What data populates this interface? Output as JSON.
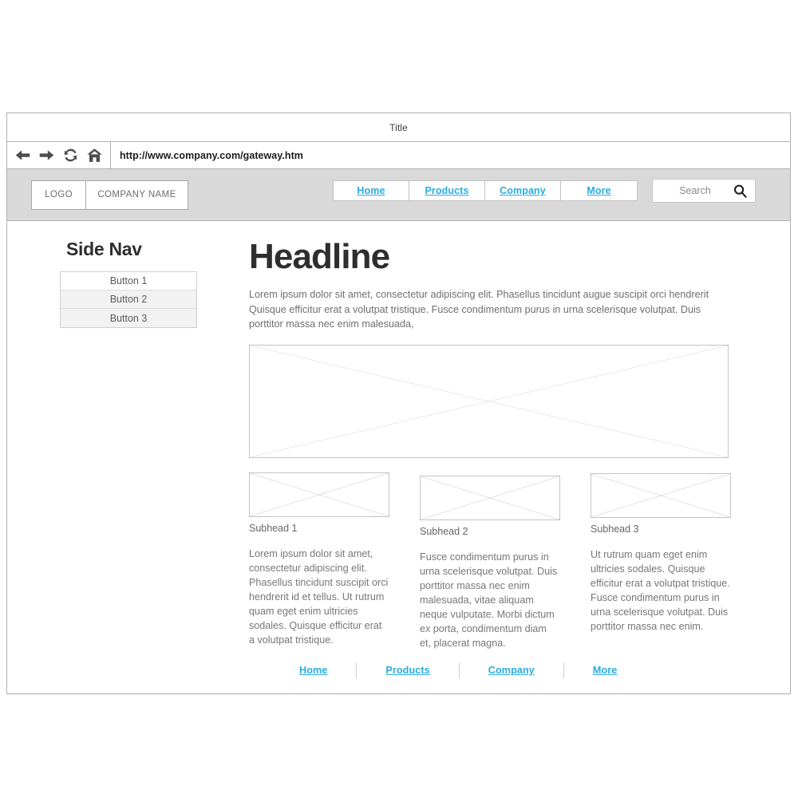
{
  "browser": {
    "title": "Title",
    "url": "http://www.company.com/gateway.htm",
    "nav_icons": {
      "back": "back-arrow-icon",
      "forward": "forward-arrow-icon",
      "reload": "reload-icon",
      "home": "home-icon"
    }
  },
  "site_header": {
    "logo_label": "LOGO",
    "company_name": "COMPANY NAME",
    "nav": [
      {
        "label": "Home"
      },
      {
        "label": "Products"
      },
      {
        "label": "Company"
      },
      {
        "label": "More"
      }
    ],
    "search": {
      "placeholder": "Search",
      "icon": "magnifier-icon"
    }
  },
  "side_nav": {
    "title": "Side Nav",
    "buttons": [
      {
        "label": "Button 1",
        "state": "active"
      },
      {
        "label": "Button 2",
        "state": "idle"
      },
      {
        "label": "Button 3",
        "state": "idle"
      }
    ]
  },
  "main": {
    "headline": "Headline",
    "intro": "Lorem ipsum dolor sit amet, consectetur adipiscing elit. Phasellus tincidunt augue suscipit orci hendrerit Quisque efficitur erat a volutpat tristique. Fusce condimentum purus in urna scelerisque volutpat. Duis porttitor massa nec enim malesuada,",
    "hero_image_alt": "image-placeholder",
    "columns": [
      {
        "subhead": "Subhead 1",
        "text": "Lorem ipsum dolor sit amet, consectetur adipiscing elit. Phasellus tincidunt suscipit orci hendrerit id et tellus. Ut rutrum quam eget enim ultricies sodales. Quisque efficitur erat a volutpat tristique."
      },
      {
        "subhead": "Subhead 2",
        "text": " Fusce condimentum purus in urna scelerisque volutpat. Duis porttitor massa nec enim malesuada, vitae aliquam neque vulputate. Morbi dictum ex porta, condimentum diam et, placerat magna."
      },
      {
        "subhead": "Subhead 3",
        "text": "Ut rutrum quam eget enim ultricies sodales. Quisque efficitur erat a volutpat tristique. Fusce condimentum purus in urna scelerisque volutpat. Duis porttitor massa nec enim."
      }
    ]
  },
  "footer": {
    "links": [
      {
        "label": "Home"
      },
      {
        "label": "Products"
      },
      {
        "label": "Company"
      },
      {
        "label": "More"
      }
    ]
  },
  "colors": {
    "link": "#29abe2",
    "header_band": "#d9d9d9",
    "frame_border": "#b0b0b0",
    "placeholder_stroke": "#c4c4c4",
    "button_idle": "#f2f2f2"
  }
}
